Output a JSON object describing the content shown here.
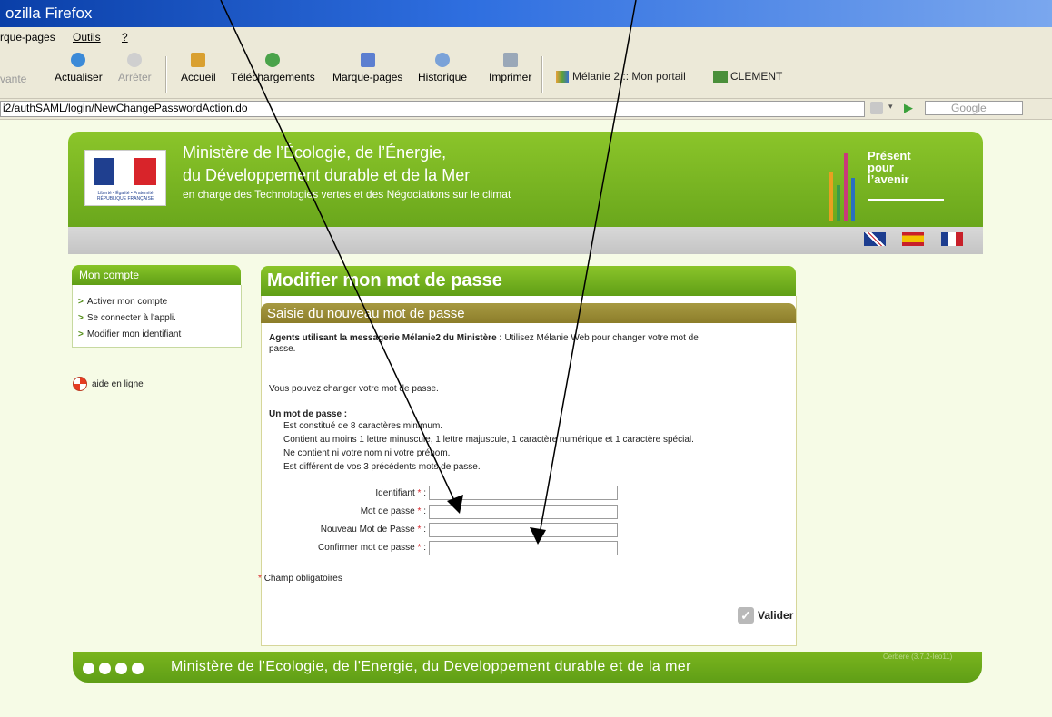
{
  "window": {
    "title": "ozilla Firefox"
  },
  "menu": {
    "items": [
      "rque-pages",
      "Outils",
      "?"
    ]
  },
  "toolbar": {
    "buttons": [
      {
        "label": "vante",
        "icon": "forward-icon",
        "enabled": false
      },
      {
        "label": "Actualiser",
        "icon": "reload-icon",
        "enabled": true
      },
      {
        "label": "Arrêter",
        "icon": "stop-icon",
        "enabled": false
      },
      {
        "label": "Accueil",
        "icon": "home-icon",
        "enabled": true
      },
      {
        "label": "Téléchargements",
        "icon": "download-icon",
        "enabled": true
      },
      {
        "label": "Marque-pages",
        "icon": "bookmarks-icon",
        "enabled": true
      },
      {
        "label": "Historique",
        "icon": "history-icon",
        "enabled": true
      },
      {
        "label": "Imprimer",
        "icon": "print-icon",
        "enabled": true
      }
    ],
    "bookmarks": [
      "Mélanie 2 :: Mon portail",
      "CLEMENT"
    ]
  },
  "urlbar": {
    "value": "i2/authSAML/login/NewChangePasswordAction.do",
    "search_placeholder": "Google"
  },
  "banner": {
    "line1": "Ministère de l’Écologie, de l’Énergie,",
    "line2": "du Développement durable et de la Mer",
    "line3": "en charge des Technologies vertes et des Négociations sur le climat",
    "present1": "Présent",
    "present2": "pour",
    "present3": "l’avenir",
    "logo_text1": "Liberté • Égalité • Fraternité",
    "logo_text2": "RÉPUBLIQUE FRANÇAISE"
  },
  "languages": [
    "en",
    "es",
    "fr"
  ],
  "sidebar": {
    "title": "Mon compte",
    "items": [
      {
        "label": "Activer mon compte"
      },
      {
        "label": "Se connecter à l'appli."
      },
      {
        "label": "Modifier mon identifiant"
      }
    ],
    "help": "aide en ligne"
  },
  "main": {
    "title": "Modifier mon mot de passe",
    "subtitle": "Saisie du nouveau mot de passe",
    "agents_bold": "Agents utilisant la messagerie Mélanie2 du Ministère :",
    "agents_rest": " Utilisez Mélanie Web pour changer votre mot de",
    "agents_rest2": "passe.",
    "intro": "Vous pouvez changer votre mot de passe.",
    "rules_title": "Un mot de passe :",
    "rules": [
      "Est constitué de 8 caractères minimum.",
      "Contient au moins 1 lettre minuscule, 1 lettre majuscule, 1 caractère numérique et 1 caractère spécial.",
      "Ne contient ni votre nom ni votre prénom.",
      "Est différent de vos 3 précédents mots de passe."
    ],
    "fields": [
      {
        "label": "Identifiant",
        "value": ""
      },
      {
        "label": "Mot de passe",
        "value": ""
      },
      {
        "label": "Nouveau Mot de Passe",
        "value": ""
      },
      {
        "label": "Confirmer mot de passe",
        "value": ""
      }
    ],
    "required_mark": "*",
    "required_note": "Champ obligatoires",
    "submit": "Valider"
  },
  "footer": {
    "text": "Ministère de l'Ecologie, de l'Energie, du Developpement durable et de la mer",
    "version": "Cerbere (3.7.2-Ieo11)"
  },
  "colors": {
    "green": "#6aa71c",
    "olive": "#8c7d2a",
    "required": "#d8242a"
  }
}
